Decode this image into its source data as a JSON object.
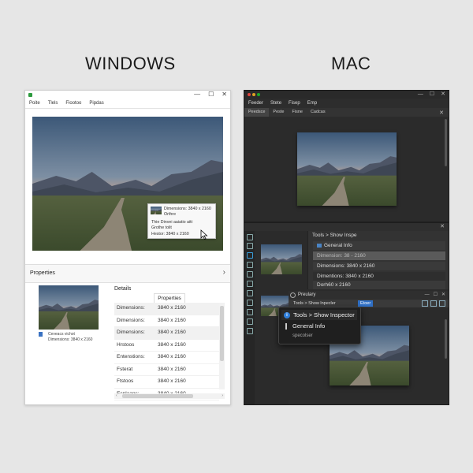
{
  "headings": {
    "windows": "WINDOWS",
    "mac": "MAC"
  },
  "windows": {
    "title_controls": [
      "—",
      "☐",
      "✕"
    ],
    "menu": [
      "Poite",
      "Tlels",
      "Fiootoo",
      "Pipdas"
    ],
    "tooltip": {
      "line1": "Dimensions: 3840 x 2160",
      "line2": "Orthre",
      "line3": "Thie Dinvei aaiatio aitt",
      "line4": "Grothe tolit",
      "line5": "Hestor: 3840 x 2160"
    },
    "properties_label": "Properties",
    "properties_chevron": "›",
    "thumb_caption_1": "Ceveacs vichot",
    "thumb_caption_2": "Dimensions: 3840 x 2160",
    "details_label": "Details",
    "properties_tab": "Properties",
    "rows": [
      {
        "key": "Dimensions:",
        "value": "3840 x 2160"
      },
      {
        "key": "Dimensions:",
        "value": "3840 x 2160"
      },
      {
        "key": "Dimensions:",
        "value": "3840 x 2160"
      },
      {
        "key": "Hrstoos",
        "value": "3840 x 2160"
      },
      {
        "key": "Entenstions:",
        "value": "3840 x 2160"
      },
      {
        "key": "Fsterat",
        "value": "3840 x 2160"
      },
      {
        "key": "Ftstoos",
        "value": "3840 x 2160"
      },
      {
        "key": "Ecplaans:",
        "value": "3840 x 2160"
      }
    ],
    "hscroll_left": "‹",
    "hscroll_right": "›"
  },
  "mac": {
    "title_controls": [
      "—",
      "☐",
      "✕"
    ],
    "menu": [
      "Feeder",
      "Stete",
      "Fisep",
      "Emp"
    ],
    "tabs": [
      "Peedsce",
      "Peste",
      "Fisne",
      "Cadcas"
    ],
    "tabs_close": "✕",
    "panel_close": "✕",
    "inspector": {
      "header": "Tools > Show Inspe",
      "rows": [
        "General Info",
        "Dimension: 38 - 2160",
        "Dimensions: 3840 x 2160",
        "Dimentions: 3840 x 2160",
        "Dorh60 x 2160"
      ]
    },
    "preview": {
      "title": "Preulary",
      "controls": [
        "—",
        "☐",
        "✕"
      ],
      "subbar_text": "Tools > Show lnpecler",
      "subbar_button": "Etoer"
    },
    "dropdown": {
      "item1": "Tools > Show Inspector",
      "item1_icon": "i",
      "item2": "General Info",
      "item3": "specolser"
    }
  },
  "colors": {
    "accent_blue": "#2f7fdc",
    "windows_bg": "#ffffff",
    "mac_bg": "#2b2b2b",
    "page_bg": "#e6e6e6"
  }
}
